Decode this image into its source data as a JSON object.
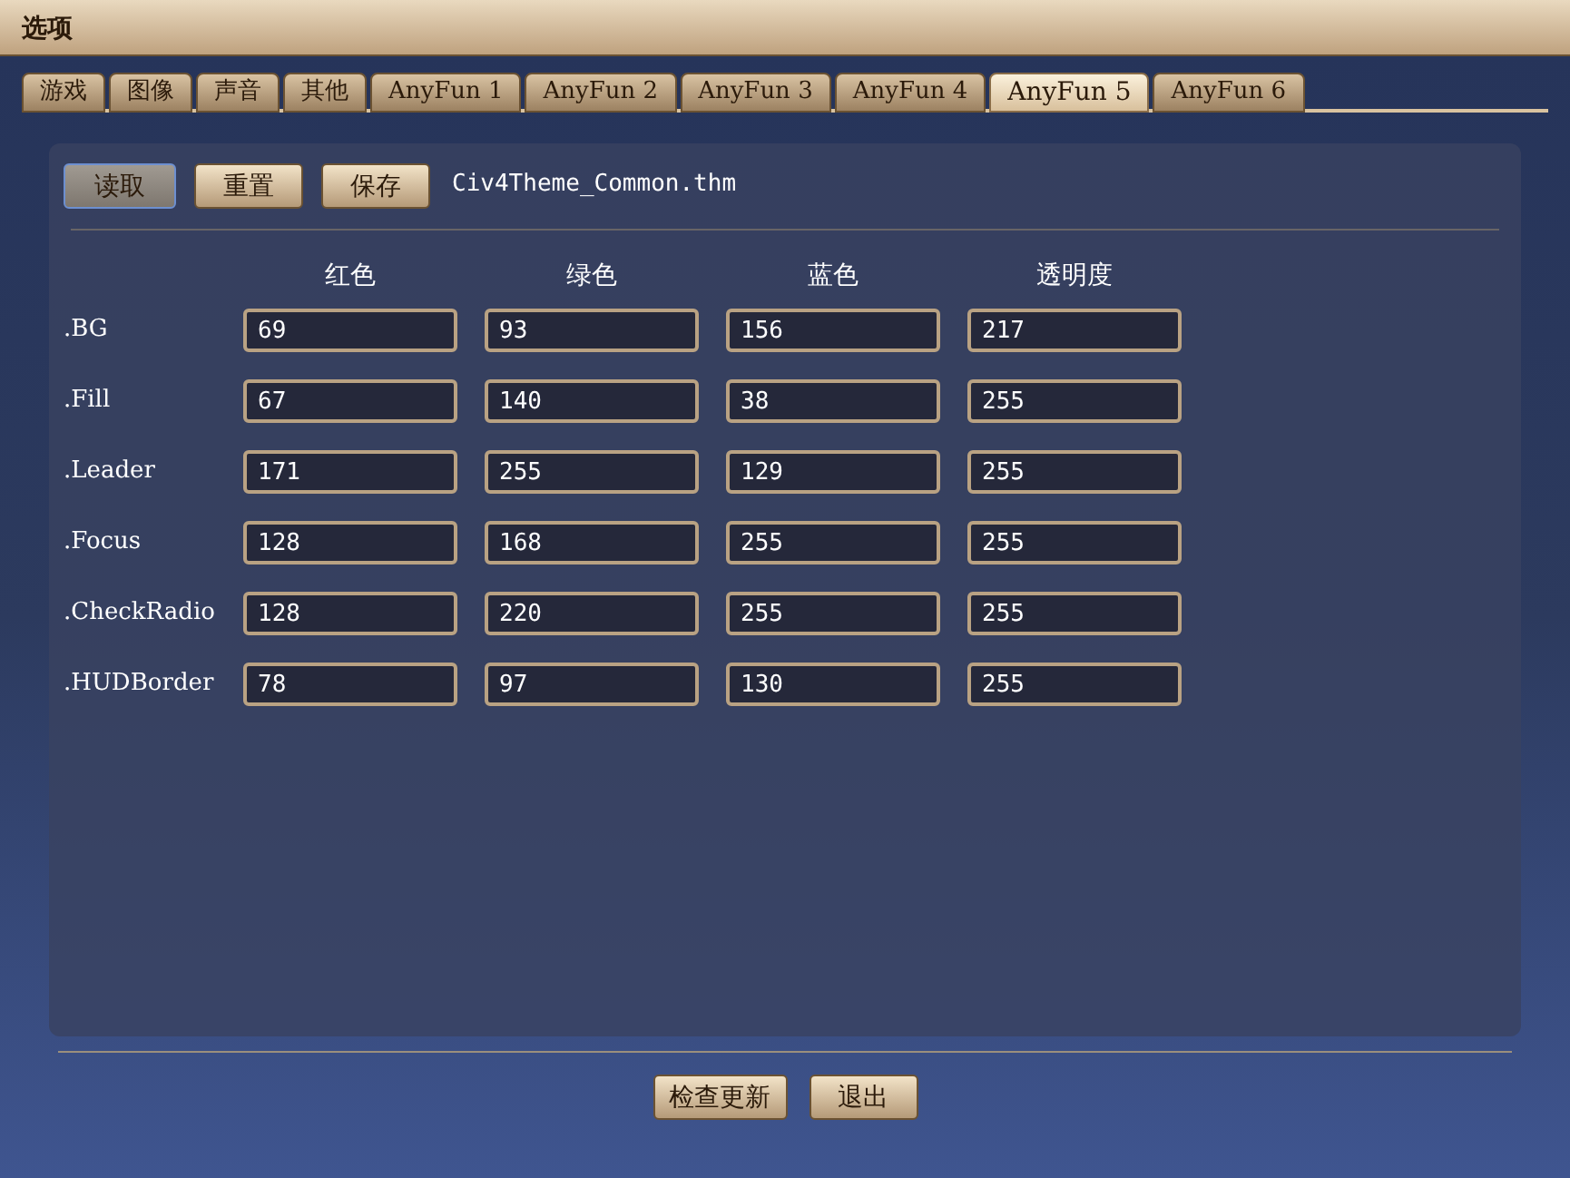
{
  "window": {
    "title": "选项"
  },
  "tabs": [
    {
      "label": "游戏",
      "selected": false
    },
    {
      "label": "图像",
      "selected": false
    },
    {
      "label": "声音",
      "selected": false
    },
    {
      "label": "其他",
      "selected": false
    },
    {
      "label": "AnyFun 1",
      "selected": false
    },
    {
      "label": "AnyFun 2",
      "selected": false
    },
    {
      "label": "AnyFun 3",
      "selected": false
    },
    {
      "label": "AnyFun 4",
      "selected": false
    },
    {
      "label": "AnyFun 5",
      "selected": true
    },
    {
      "label": "AnyFun 6",
      "selected": false
    }
  ],
  "toolbar": {
    "buttons": [
      {
        "label": "读取",
        "pressed": true
      },
      {
        "label": "重置",
        "pressed": false
      },
      {
        "label": "保存",
        "pressed": false
      }
    ],
    "file_name": "Civ4Theme_Common.thm"
  },
  "table": {
    "columns": [
      "红色",
      "绿色",
      "蓝色",
      "透明度"
    ],
    "rows": [
      {
        "name": ".BG",
        "values": [
          "69",
          "93",
          "156",
          "217"
        ]
      },
      {
        "name": ".Fill",
        "values": [
          "67",
          "140",
          "38",
          "255"
        ]
      },
      {
        "name": ".Leader",
        "values": [
          "171",
          "255",
          "129",
          "255"
        ]
      },
      {
        "name": ".Focus",
        "values": [
          "128",
          "168",
          "255",
          "255"
        ]
      },
      {
        "name": ".CheckRadio",
        "values": [
          "128",
          "220",
          "255",
          "255"
        ]
      },
      {
        "name": ".HUDBorder",
        "values": [
          "78",
          "97",
          "130",
          "255"
        ]
      }
    ]
  },
  "footer_buttons": [
    "检查更新",
    "退出"
  ]
}
